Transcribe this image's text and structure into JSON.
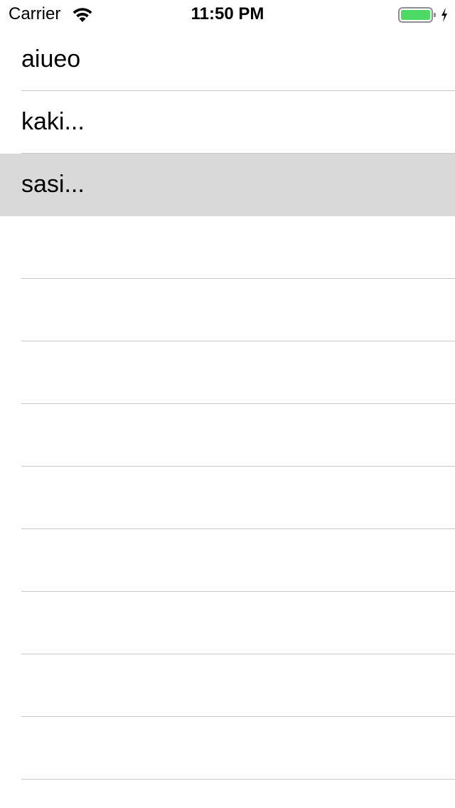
{
  "status_bar": {
    "carrier": "Carrier",
    "time": "11:50 PM",
    "battery_color": "#4cd964"
  },
  "table": {
    "rows": [
      {
        "label": "aiueo",
        "selected": false
      },
      {
        "label": "kaki...",
        "selected": false
      },
      {
        "label": "sasi...",
        "selected": true
      },
      {
        "label": "",
        "selected": false
      },
      {
        "label": "",
        "selected": false
      },
      {
        "label": "",
        "selected": false
      },
      {
        "label": "",
        "selected": false
      },
      {
        "label": "",
        "selected": false
      },
      {
        "label": "",
        "selected": false
      },
      {
        "label": "",
        "selected": false
      },
      {
        "label": "",
        "selected": false
      },
      {
        "label": "",
        "selected": false
      },
      {
        "label": "",
        "selected": false
      }
    ],
    "selection_color": "#d9d9d9",
    "separator_color": "#c8c7cc"
  }
}
